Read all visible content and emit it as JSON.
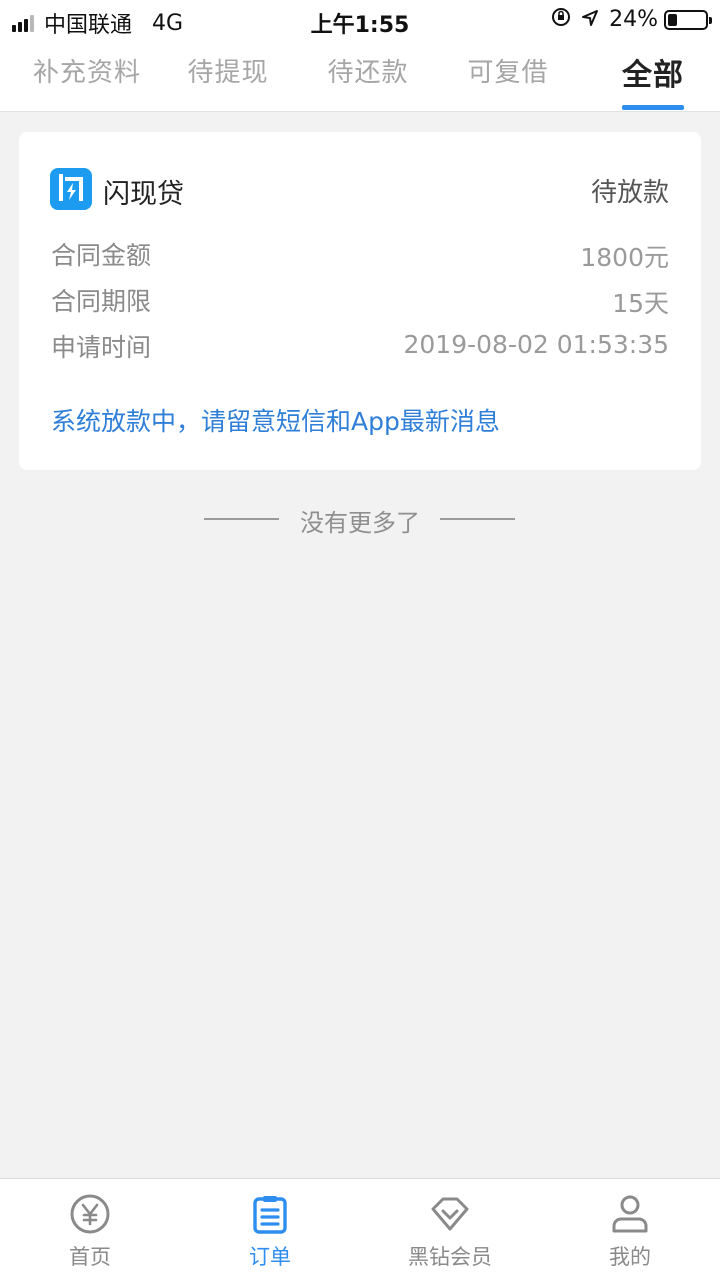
{
  "status_bar": {
    "carrier": "中国联通",
    "network": "4G",
    "time": "上午1:55",
    "battery": "24%",
    "battery_level": 0.24,
    "icons": [
      "orientation-lock-icon",
      "location-arrow-icon",
      "battery-icon"
    ]
  },
  "tabs": [
    {
      "label": "补充资料",
      "active": false
    },
    {
      "label": "待提现",
      "active": false
    },
    {
      "label": "待还款",
      "active": false
    },
    {
      "label": "可复借",
      "active": false
    },
    {
      "label": "全部",
      "active": true
    }
  ],
  "order": {
    "product_name": "闪现贷",
    "status": "待放款",
    "rows": [
      {
        "label": "合同金额",
        "value": "1800元"
      },
      {
        "label": "合同期限",
        "value": "15天"
      },
      {
        "label": "申请时间",
        "value": "2019-08-02 01:53:35"
      }
    ],
    "notice": "系统放款中，请留意短信和App最新消息"
  },
  "list_end_text": "没有更多了",
  "bottom_nav": [
    {
      "label": "首页",
      "icon": "yen-coin-icon",
      "active": false
    },
    {
      "label": "订单",
      "icon": "clipboard-list-icon",
      "active": true
    },
    {
      "label": "黑钻会员",
      "icon": "diamond-icon",
      "active": false
    },
    {
      "label": "我的",
      "icon": "user-icon",
      "active": false
    }
  ],
  "colors": {
    "accent": "#2e8ef0",
    "notice": "#2f7fd8",
    "brand_logo": "#1d9bf0",
    "background": "#f2f2f2"
  }
}
